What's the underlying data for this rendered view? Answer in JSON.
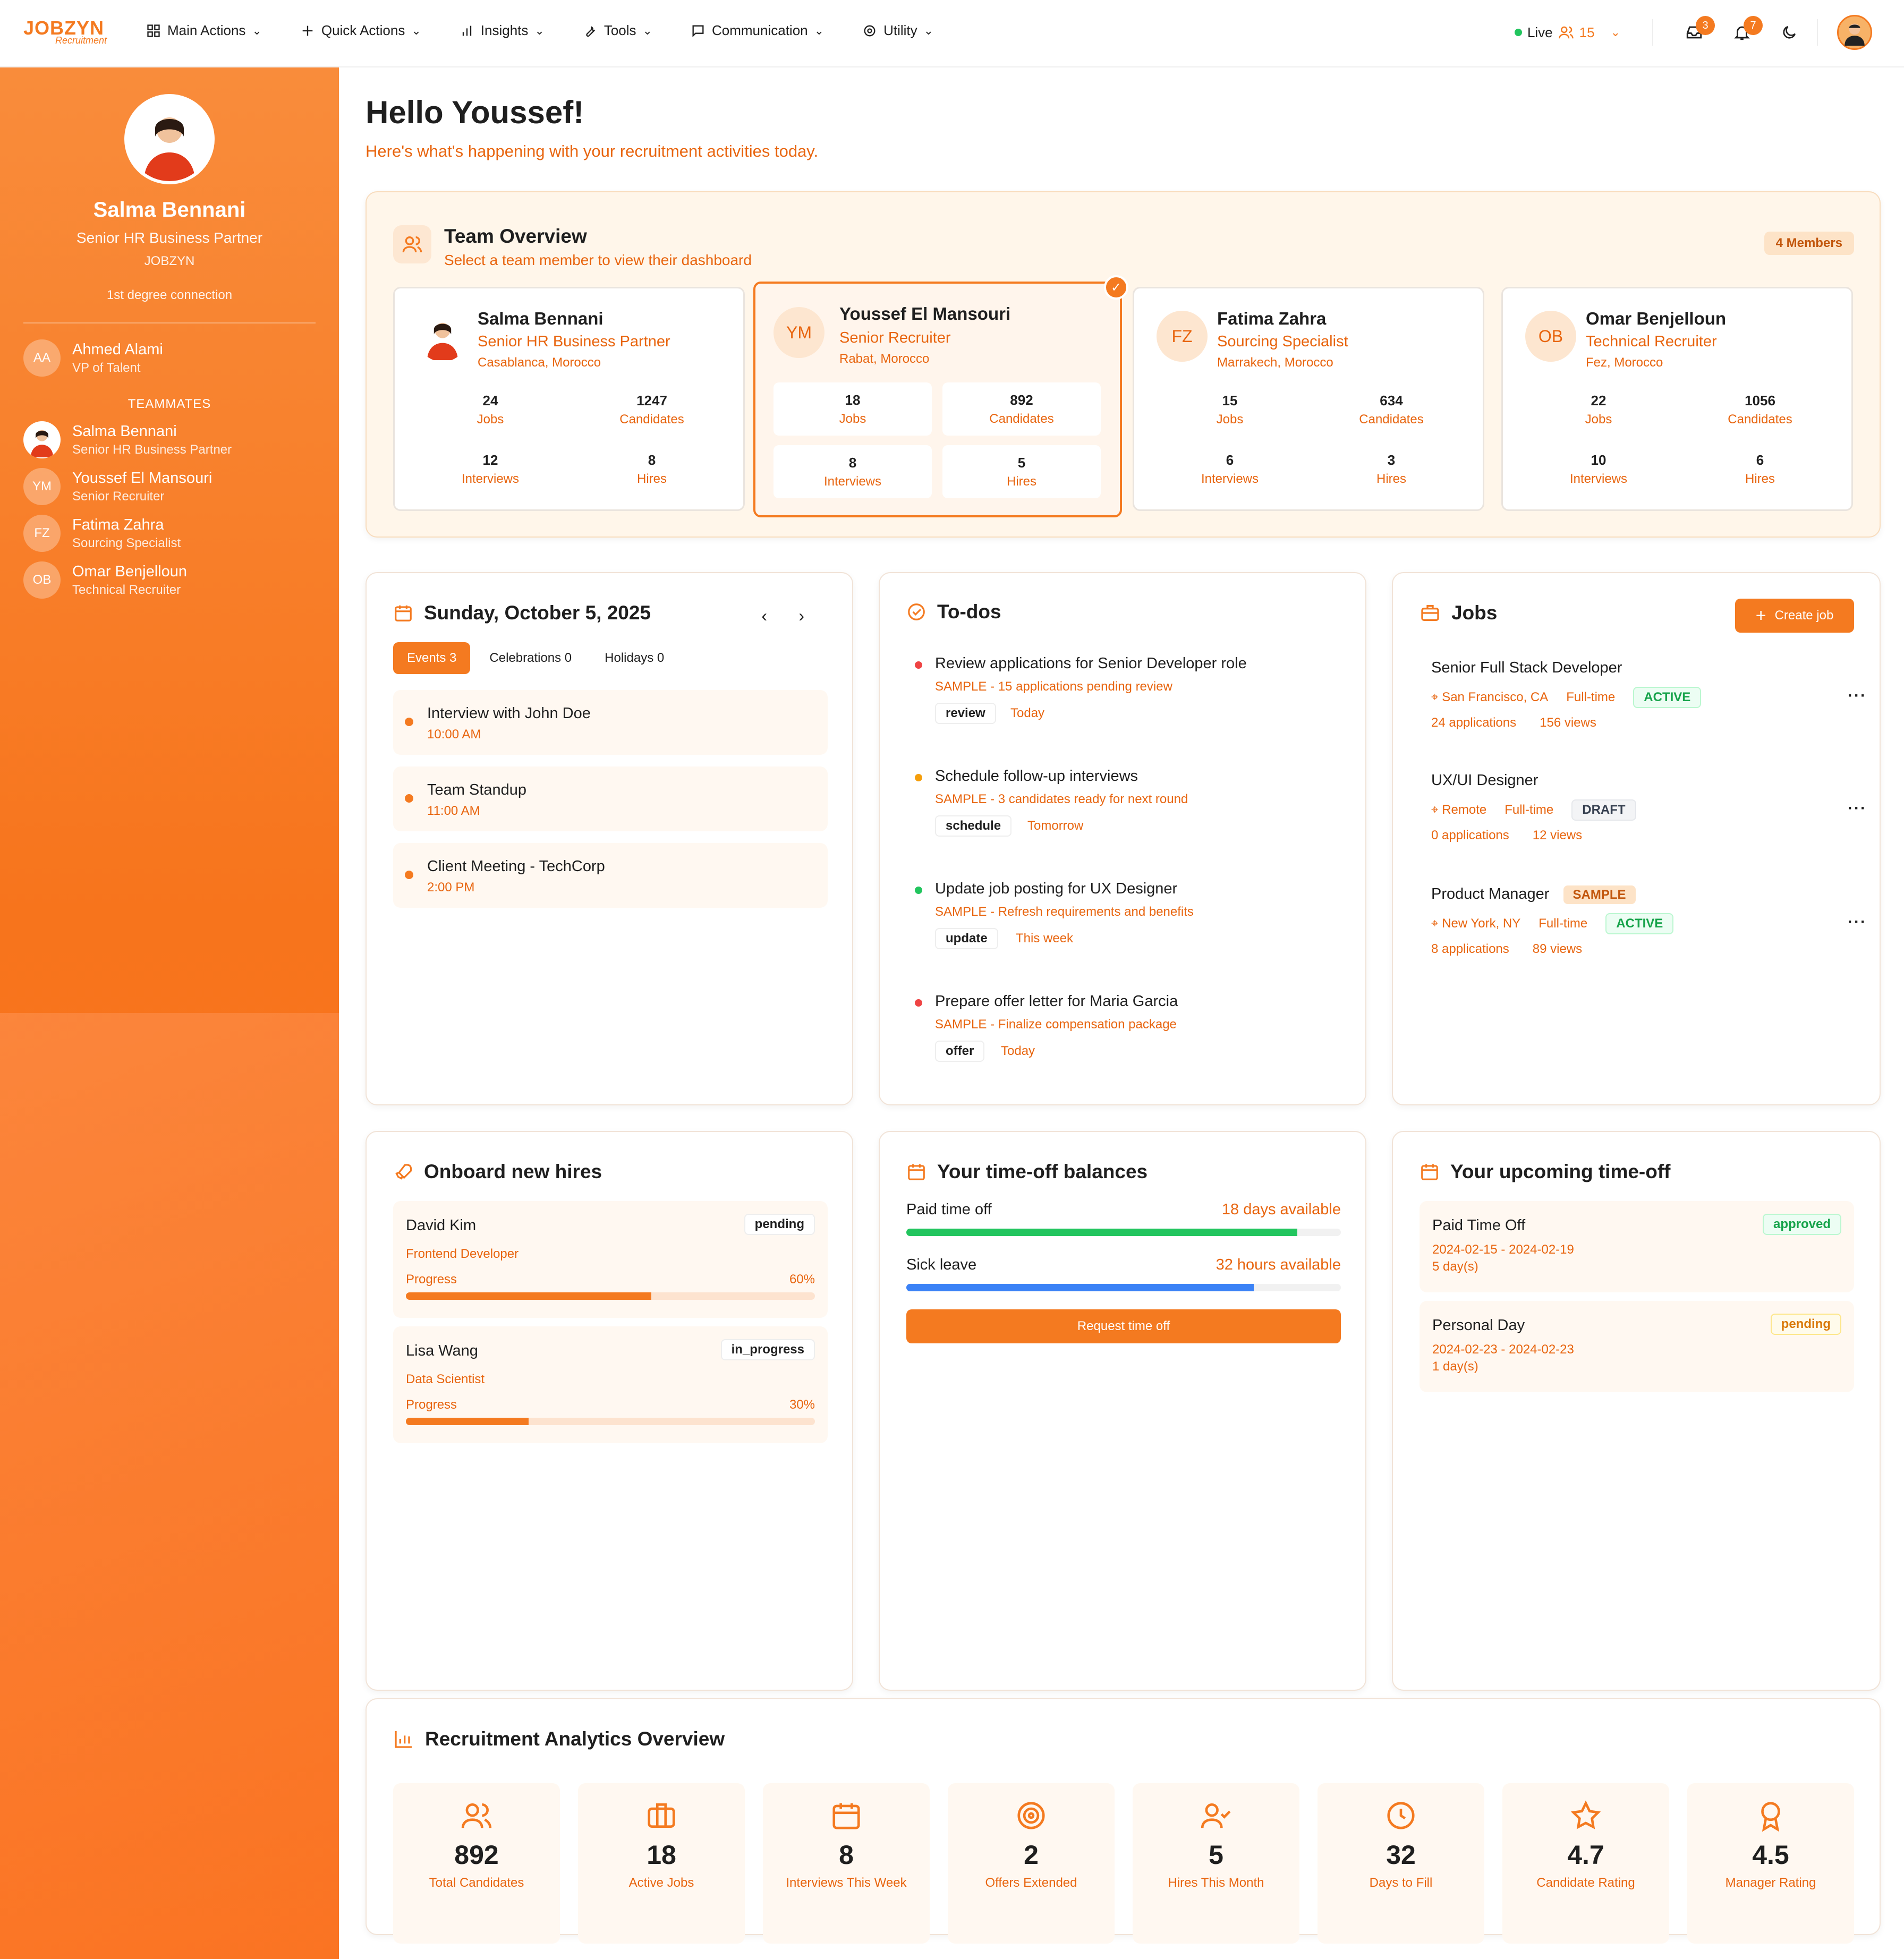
{
  "brand": {
    "logo": "JOBZYN",
    "logo_sub": "Recruitment",
    "accent": "#f47a20"
  },
  "nav": [
    {
      "label": "Main Actions",
      "icon": "grid-icon"
    },
    {
      "label": "Quick Actions",
      "icon": "plus-icon"
    },
    {
      "label": "Insights",
      "icon": "bar-chart-icon"
    },
    {
      "label": "Tools",
      "icon": "wrench-icon"
    },
    {
      "label": "Communication",
      "icon": "message-icon"
    },
    {
      "label": "Utility",
      "icon": "gear-icon"
    }
  ],
  "topright": {
    "live_label": "Live",
    "live_count": "15",
    "inbox_count": "3",
    "notif_count": "7"
  },
  "sidebar": {
    "profile": {
      "name": "Salma Bennani",
      "title": "Senior HR Business Partner",
      "company": "JOBZYN",
      "connection": "1st degree connection"
    },
    "manager": {
      "initials": "AA",
      "name": "Ahmed Alami",
      "role": "VP of Talent"
    },
    "teammates_label": "TEAMMATES",
    "teammates": [
      {
        "initials": "",
        "name": "Salma Bennani",
        "role": "Senior HR Business Partner"
      },
      {
        "initials": "YM",
        "name": "Youssef El Mansouri",
        "role": "Senior Recruiter"
      },
      {
        "initials": "FZ",
        "name": "Fatima Zahra",
        "role": "Sourcing Specialist"
      },
      {
        "initials": "OB",
        "name": "Omar Benjelloun",
        "role": "Technical Recruiter"
      }
    ]
  },
  "greeting": {
    "title": "Hello Youssef!",
    "subtitle": "Here's what's happening with your recruitment activities today."
  },
  "team": {
    "title": "Team Overview",
    "subtitle": "Select a team member to view their dashboard",
    "badge": "4 Members",
    "members": [
      {
        "initials": "",
        "name": "Salma Bennani",
        "role": "Senior HR Business Partner",
        "location": "Casablanca, Morocco",
        "jobs": "24",
        "candidates": "1247",
        "interviews": "12",
        "hires": "8"
      },
      {
        "initials": "YM",
        "name": "Youssef El Mansouri",
        "role": "Senior Recruiter",
        "location": "Rabat, Morocco",
        "jobs": "18",
        "candidates": "892",
        "interviews": "8",
        "hires": "5"
      },
      {
        "initials": "FZ",
        "name": "Fatima Zahra",
        "role": "Sourcing Specialist",
        "location": "Marrakech, Morocco",
        "jobs": "15",
        "candidates": "634",
        "interviews": "6",
        "hires": "3"
      },
      {
        "initials": "OB",
        "name": "Omar Benjelloun",
        "role": "Technical Recruiter",
        "location": "Fez, Morocco",
        "jobs": "22",
        "candidates": "1056",
        "interviews": "10",
        "hires": "6"
      }
    ],
    "labels": {
      "jobs": "Jobs",
      "candidates": "Candidates",
      "interviews": "Interviews",
      "hires": "Hires"
    }
  },
  "calendar": {
    "date": "Sunday, October 5, 2025",
    "tabs": [
      {
        "label": "Events 3"
      },
      {
        "label": "Celebrations 0"
      },
      {
        "label": "Holidays 0"
      }
    ],
    "events": [
      {
        "title": "Interview with John Doe",
        "time": "10:00 AM"
      },
      {
        "title": "Team Standup",
        "time": "11:00 AM"
      },
      {
        "title": "Client Meeting - TechCorp",
        "time": "2:00 PM"
      }
    ]
  },
  "todos": {
    "title": "To-dos",
    "items": [
      {
        "title": "Review applications for Senior Developer role",
        "sub": "SAMPLE - 15 applications pending review",
        "tag": "review",
        "due": "Today",
        "color": "#ef4444"
      },
      {
        "title": "Schedule follow-up interviews",
        "sub": "SAMPLE - 3 candidates ready for next round",
        "tag": "schedule",
        "due": "Tomorrow",
        "color": "#f59e0b"
      },
      {
        "title": "Update job posting for UX Designer",
        "sub": "SAMPLE - Refresh requirements and benefits",
        "tag": "update",
        "due": "This week",
        "color": "#22c55e"
      },
      {
        "title": "Prepare offer letter for Maria Garcia",
        "sub": "SAMPLE - Finalize compensation package",
        "tag": "offer",
        "due": "Today",
        "color": "#ef4444"
      }
    ]
  },
  "jobs": {
    "title": "Jobs",
    "create_label": "Create job",
    "items": [
      {
        "title": "Senior Full Stack Developer",
        "location": "San Francisco, CA",
        "type": "Full-time",
        "status": "ACTIVE",
        "applications": "24 applications",
        "views": "156 views"
      },
      {
        "title": "UX/UI Designer",
        "location": "Remote",
        "type": "Full-time",
        "status": "DRAFT",
        "applications": "0 applications",
        "views": "12 views"
      },
      {
        "title": "Product Manager",
        "badge": "SAMPLE",
        "location": "New York, NY",
        "type": "Full-time",
        "status": "ACTIVE",
        "applications": "8 applications",
        "views": "89 views"
      }
    ]
  },
  "onboard": {
    "title": "Onboard new hires",
    "progress_label": "Progress",
    "items": [
      {
        "name": "David Kim",
        "role": "Frontend Developer",
        "status": "pending",
        "progress": "60%",
        "progress_value": 60
      },
      {
        "name": "Lisa Wang",
        "role": "Data Scientist",
        "status": "in_progress",
        "progress": "30%",
        "progress_value": 30
      }
    ]
  },
  "timeoff": {
    "title": "Your time-off balances",
    "items": [
      {
        "label": "Paid time off",
        "value": "18 days available",
        "fill": 0.9,
        "color": "#22c55e"
      },
      {
        "label": "Sick leave",
        "value": "32 hours available",
        "fill": 0.8,
        "color": "#3b82f6"
      }
    ],
    "button": "Request time off"
  },
  "upcoming": {
    "title": "Your upcoming time-off",
    "items": [
      {
        "name": "Paid Time Off",
        "dates": "2024-02-15 - 2024-02-19",
        "days": "5 day(s)",
        "status": "approved"
      },
      {
        "name": "Personal Day",
        "dates": "2024-02-23 - 2024-02-23",
        "days": "1 day(s)",
        "status": "pending"
      }
    ]
  },
  "analytics": {
    "title": "Recruitment Analytics Overview",
    "stats": [
      {
        "value": "892",
        "label": "Total Candidates",
        "icon": "users-icon"
      },
      {
        "value": "18",
        "label": "Active Jobs",
        "icon": "briefcase-icon"
      },
      {
        "value": "8",
        "label": "Interviews This Week",
        "icon": "calendar-icon"
      },
      {
        "value": "2",
        "label": "Offers Extended",
        "icon": "target-icon"
      },
      {
        "value": "5",
        "label": "Hires This Month",
        "icon": "user-check-icon"
      },
      {
        "value": "32",
        "label": "Days to Fill",
        "icon": "clock-icon"
      },
      {
        "value": "4.7",
        "label": "Candidate Rating",
        "icon": "star-icon"
      },
      {
        "value": "4.5",
        "label": "Manager Rating",
        "icon": "award-icon"
      }
    ]
  }
}
